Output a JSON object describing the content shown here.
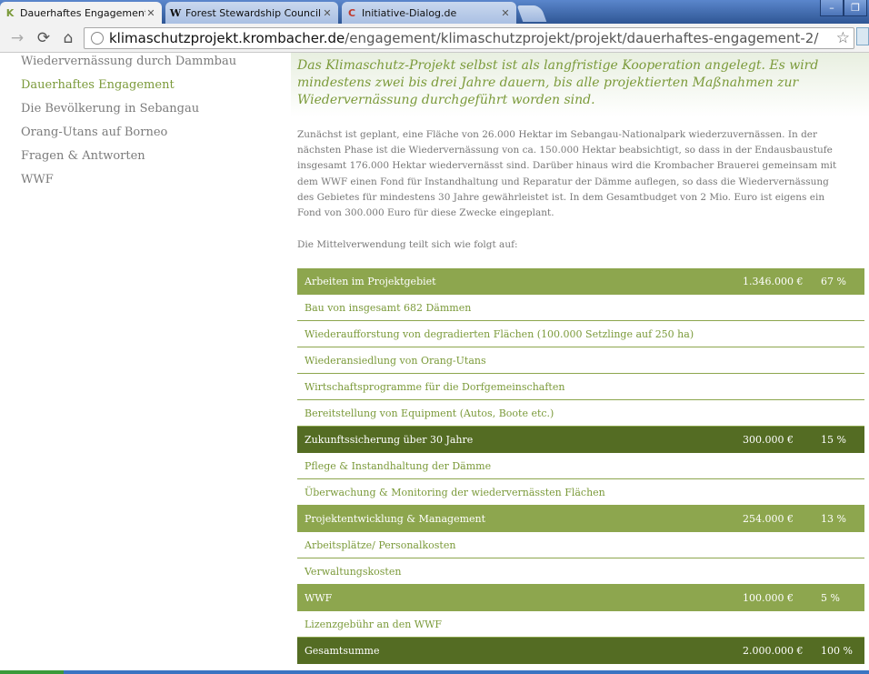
{
  "browser": {
    "tabs": [
      {
        "title": "Dauerhaftes Engagement | Kli",
        "favicon": "K",
        "state": "active"
      },
      {
        "title": "Forest Stewardship Council – \\",
        "favicon": "W",
        "state": "inactive"
      },
      {
        "title": "Initiative-Dialog.de",
        "favicon": "C",
        "state": "inactive"
      }
    ],
    "window_buttons": {
      "minimize": "–",
      "maximize": "❐"
    },
    "address": {
      "host": "klimaschutzprojekt.krombacher.de",
      "path": "/engagement/klimaschutzprojekt/projekt/dauerhaftes-engagement-2/"
    },
    "nav": {
      "back": "→",
      "reload": "⟳",
      "home": "⌂",
      "star": "☆"
    }
  },
  "sidebar": {
    "items": [
      {
        "label": "Wiedervernässung durch Dammbau",
        "current": false
      },
      {
        "label": "Dauerhaftes Engagement",
        "current": true
      },
      {
        "label": "Die Bevölkerung in Sebangau",
        "current": false
      },
      {
        "label": "Orang-Utans auf Borneo",
        "current": false
      },
      {
        "label": "Fragen & Antworten",
        "current": false
      },
      {
        "label": "WWF",
        "current": false
      }
    ]
  },
  "content": {
    "lead": "Das Klimaschutz-Projekt selbst ist als langfristige Kooperation angelegt. Es wird mindestens zwei bis drei Jahre dauern, bis alle projektierten Maßnahmen zur Wiedervernässung durchgeführt worden sind.",
    "body": "Zunächst ist geplant, eine Fläche von 26.000 Hektar im Sebangau-Nationalpark wiederzuvernässen. In der nächsten Phase ist die Wiedervernässung von ca. 150.000 Hektar beabsichtigt, so dass in der Endausbaustufe insgesamt 176.000 Hektar wiedervernässt sind. Darüber hinaus wird die Krombacher Brauerei gemeinsam mit dem WWF einen Fond für Instandhaltung und Reparatur der Dämme auflegen, so dass die Wiedervernässung des Gebietes für mindestens 30 Jahre gewährleistet ist. In dem Gesamtbudget von 2 Mio. Euro ist eigens ein Fond von 300.000 Euro für diese Zwecke eingeplant.",
    "intro": "Die Mittelverwendung teilt sich wie folgt auf:"
  },
  "cost_table": {
    "rows": [
      {
        "kind": "head",
        "shade": "light",
        "label": "Arbeiten im Projektgebiet",
        "amount": "1.346.000 €",
        "percent": "67 %"
      },
      {
        "kind": "item",
        "label": "Bau von insgesamt 682 Dämmen"
      },
      {
        "kind": "item",
        "label": "Wiederaufforstung von degradierten Flächen (100.000 Setzlinge auf 250 ha)"
      },
      {
        "kind": "item",
        "label": "Wiederansiedlung von Orang-Utans"
      },
      {
        "kind": "item",
        "label": "Wirtschaftsprogramme für die Dorfgemeinschaften"
      },
      {
        "kind": "item",
        "label": "Bereitstellung von Equipment (Autos, Boote etc.)"
      },
      {
        "kind": "head",
        "shade": "dark",
        "label": "Zukunftssicherung über 30 Jahre",
        "amount": "300.000 €",
        "percent": "15 %"
      },
      {
        "kind": "item",
        "label": "Pflege & Instandhaltung der Dämme"
      },
      {
        "kind": "item",
        "label": "Überwachung & Monitoring der wiedervernässten Flächen"
      },
      {
        "kind": "head",
        "shade": "light",
        "label": "Projektentwicklung & Management",
        "amount": "254.000 €",
        "percent": "13 %"
      },
      {
        "kind": "item",
        "label": "Arbeitsplätze/ Personalkosten"
      },
      {
        "kind": "item",
        "label": "Verwaltungskosten"
      },
      {
        "kind": "head",
        "shade": "light",
        "label": "WWF",
        "amount": "100.000 €",
        "percent": "5 %"
      },
      {
        "kind": "item",
        "label": "Lizenzgebühr an den WWF"
      },
      {
        "kind": "head",
        "shade": "dark",
        "label": "Gesamtsumme",
        "amount": "2.000.000 €",
        "percent": "100 %"
      }
    ]
  },
  "colors": {
    "accent_green": "#7b9a3a",
    "row_light": "#8da64e",
    "row_dark": "#546c23",
    "text_grey": "#777777"
  }
}
